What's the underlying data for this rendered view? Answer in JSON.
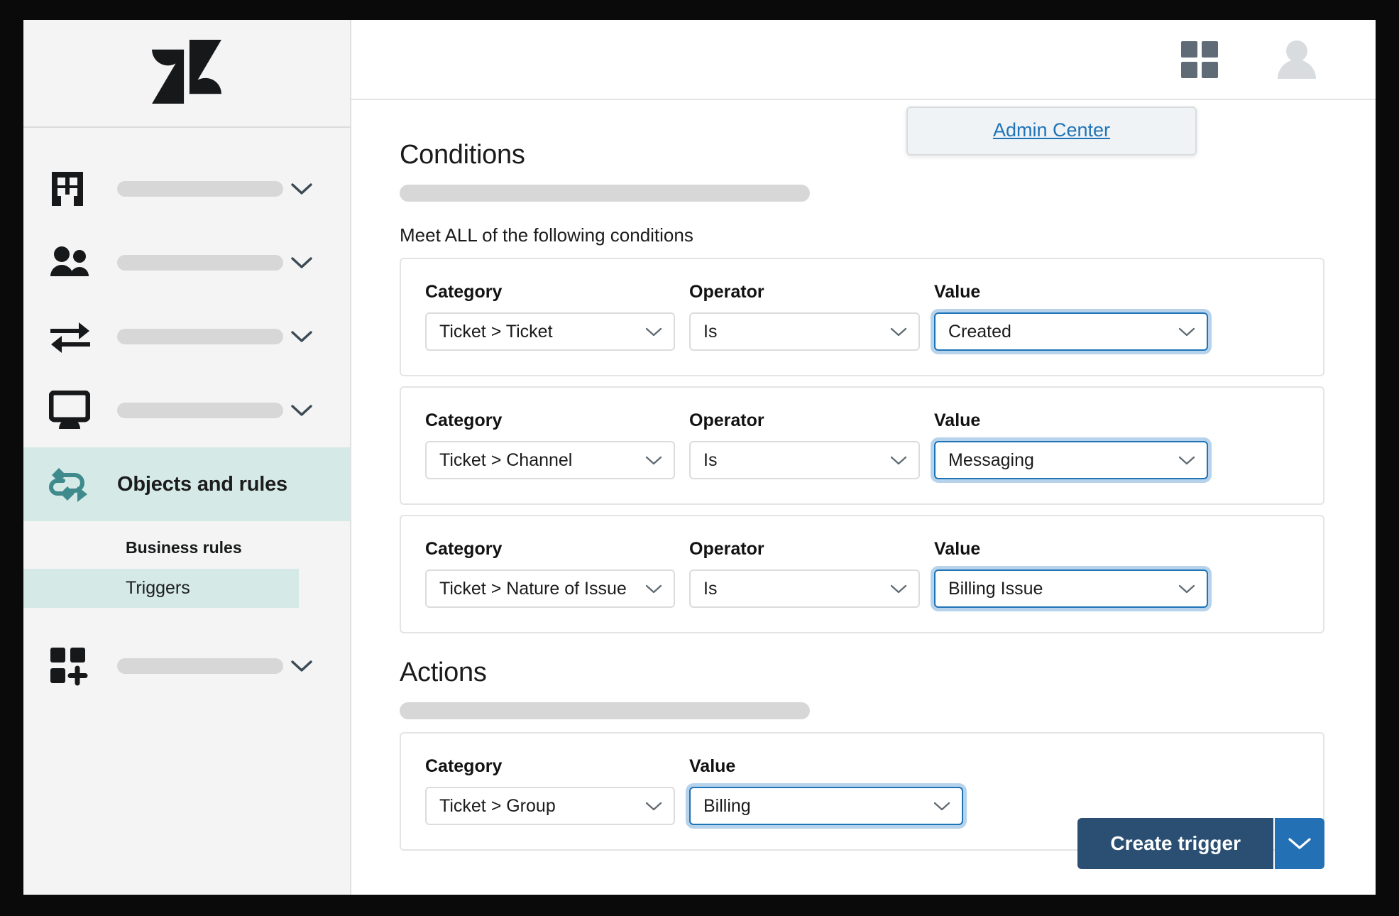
{
  "app": {
    "logo": "zendesk-logo",
    "accent_teal": "#d5eae7",
    "accent_blue": "#1f73b7",
    "primary_button_color": "#2b4f73",
    "caret_button_color": "#2470b5"
  },
  "sidebar": {
    "items": [
      {
        "icon": "building-icon",
        "label": "",
        "has_chevron": true
      },
      {
        "icon": "people-icon",
        "label": "",
        "has_chevron": true
      },
      {
        "icon": "transfer-icon",
        "label": "",
        "has_chevron": true
      },
      {
        "icon": "workspace-icon",
        "label": "",
        "has_chevron": true
      }
    ],
    "active_item": {
      "icon": "objects-rules-icon",
      "label": "Objects and rules"
    },
    "sub_section": {
      "heading": "Business rules",
      "items": [
        {
          "label": "Triggers",
          "selected": true
        }
      ]
    },
    "apps_item": {
      "icon": "apps-add-icon",
      "label": "",
      "has_chevron": true
    }
  },
  "topbar": {
    "grid_icon": "grid-apps-icon",
    "avatar_icon": "user-avatar-icon",
    "dropdown": {
      "link_label": "Admin Center"
    }
  },
  "main": {
    "conditions": {
      "title": "Conditions",
      "subtitle": "Meet ALL of the following conditions",
      "labels": {
        "category": "Category",
        "operator": "Operator",
        "value": "Value"
      },
      "rows": [
        {
          "category": "Ticket > Ticket",
          "operator": "Is",
          "value": "Created",
          "value_focused": true
        },
        {
          "category": "Ticket > Channel",
          "operator": "Is",
          "value": "Messaging",
          "value_focused": true
        },
        {
          "category": "Ticket > Nature of Issue",
          "operator": "Is",
          "value": "Billing Issue",
          "value_focused": true
        }
      ]
    },
    "actions": {
      "title": "Actions",
      "labels": {
        "category": "Category",
        "value": "Value"
      },
      "rows": [
        {
          "category": "Ticket > Group",
          "value": "Billing",
          "value_focused": true
        }
      ]
    },
    "footer": {
      "submit_label": "Create trigger",
      "caret_icon": "chevron-down-icon"
    }
  }
}
